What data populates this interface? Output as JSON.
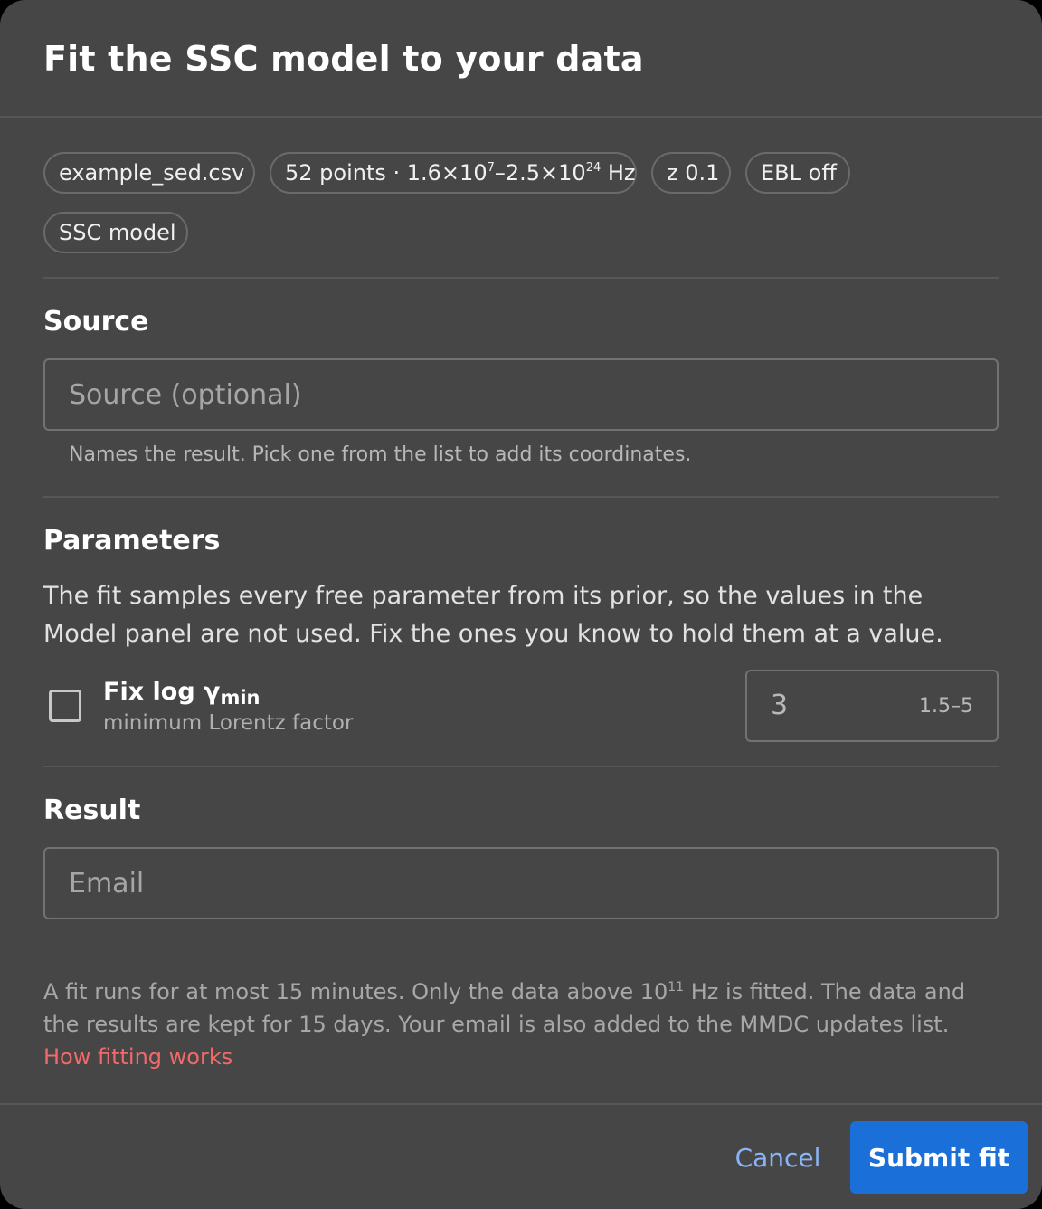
{
  "dialog": {
    "title": "Fit the SSC model to your data"
  },
  "chips": {
    "file": "example_sed.csv",
    "points_prefix": "52 points · 1.6×10",
    "points_exp1": "7",
    "points_mid": "–2.5×10",
    "points_exp2": "24",
    "points_suffix": " Hz",
    "redshift": "z 0.1",
    "ebl": "EBL off",
    "model": "SSC model"
  },
  "source": {
    "heading": "Source",
    "placeholder": "Source (optional)",
    "value": "",
    "helper": "Names the result. Pick one from the list to add its coordinates."
  },
  "parameters": {
    "heading": "Parameters",
    "description": "The fit samples every free parameter from its prior, so the values in the Model panel are not used. Fix the ones you know to hold them at a value.",
    "items": [
      {
        "label_main": "Fix log γ",
        "label_sub": "min",
        "hint": "minimum Lorentz factor",
        "checked": false,
        "value": "3",
        "range": "1.5–5"
      }
    ]
  },
  "result": {
    "heading": "Result",
    "placeholder": "Email",
    "value": ""
  },
  "footnote": {
    "part1": "A fit runs for at most 15 minutes. Only the data above 10",
    "exp": "11",
    "part2": " Hz is fitted. The data and the results are kept for 15 days. Your email is also added to the MMDC updates list. ",
    "link": "How fitting works"
  },
  "actions": {
    "cancel": "Cancel",
    "submit": "Submit fit"
  },
  "colors": {
    "background": "#464646",
    "primary": "#1a6fd8",
    "link": "#f06a6a",
    "cancel": "#8ab4f8"
  }
}
